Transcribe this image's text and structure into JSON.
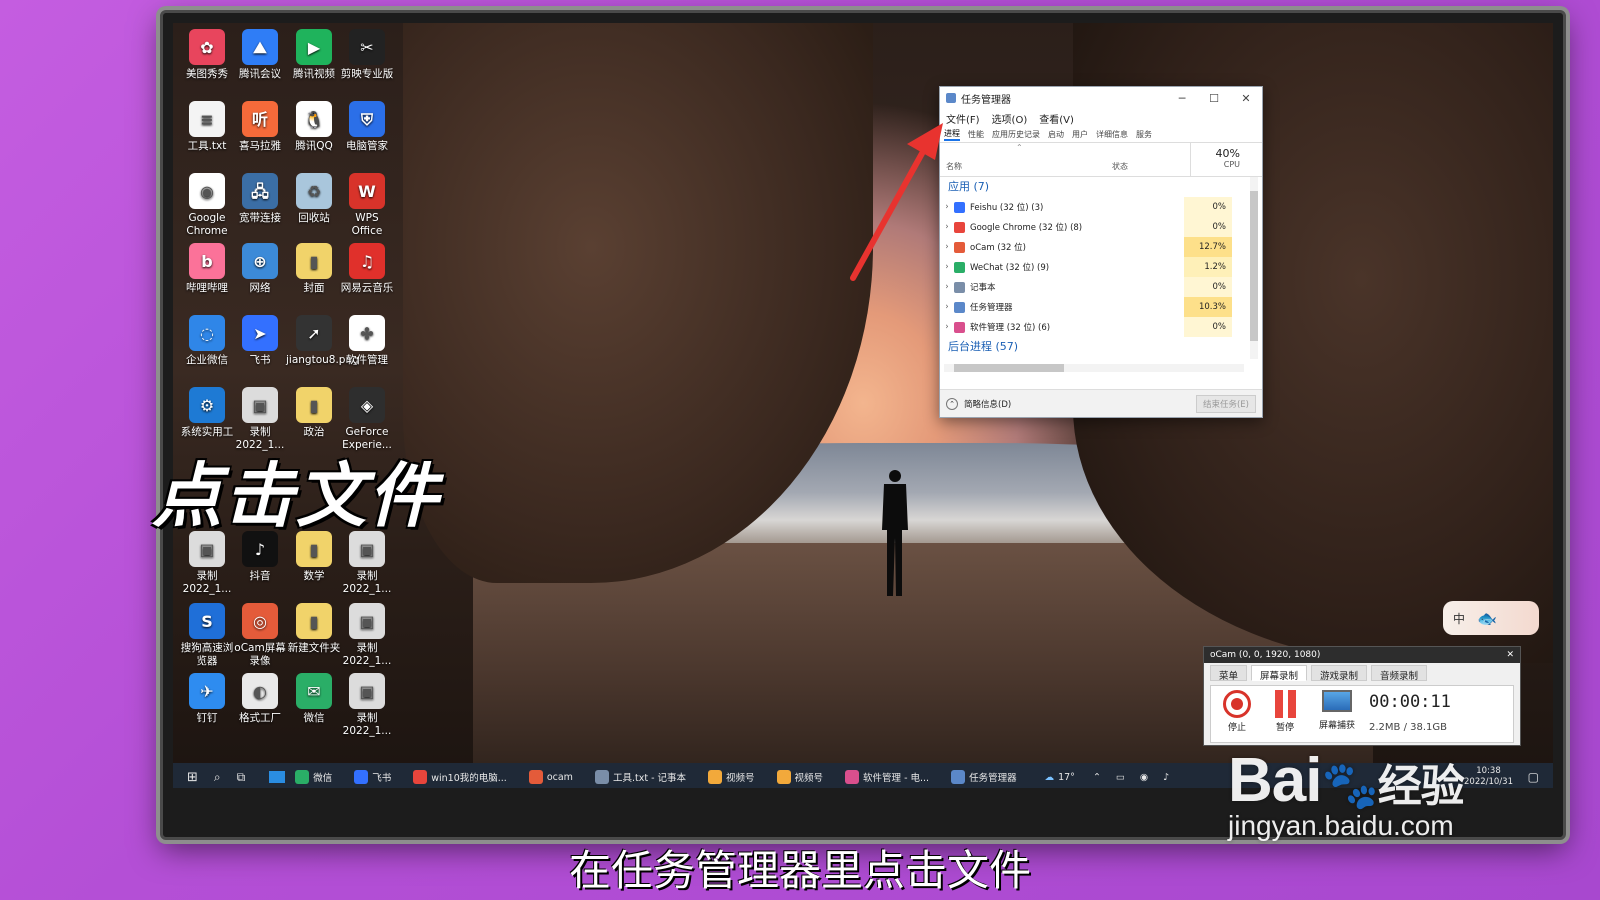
{
  "desktop_icons": [
    {
      "label": "美图秀秀",
      "color": "#e8455d",
      "glyph": "✿"
    },
    {
      "label": "腾讯会议",
      "color": "#2f7df6",
      "glyph": "⛰"
    },
    {
      "label": "腾讯视频",
      "color": "#1fb35c",
      "glyph": "▶"
    },
    {
      "label": "剪映专业版",
      "color": "#222222",
      "glyph": "✂"
    },
    {
      "label": "工具.txt",
      "color": "#f4f4f4",
      "glyph": "≡"
    },
    {
      "label": "喜马拉雅",
      "color": "#f56a3a",
      "glyph": "听"
    },
    {
      "label": "腾讯QQ",
      "color": "#ffffff",
      "glyph": "🐧"
    },
    {
      "label": "电脑管家",
      "color": "#2b6fe8",
      "glyph": "⛨"
    },
    {
      "label": "Google Chrome",
      "color": "#ffffff",
      "glyph": "◉"
    },
    {
      "label": "宽带连接",
      "color": "#3b6ea5",
      "glyph": "🖧"
    },
    {
      "label": "回收站",
      "color": "#a9c6dc",
      "glyph": "♻"
    },
    {
      "label": "WPS Office",
      "color": "#d8332a",
      "glyph": "W"
    },
    {
      "label": "哔哩哔哩",
      "color": "#fb7299",
      "glyph": "b"
    },
    {
      "label": "网络",
      "color": "#3c8ad8",
      "glyph": "⊕"
    },
    {
      "label": "封面",
      "color": "#f1d36a",
      "glyph": "▮"
    },
    {
      "label": "网易云音乐",
      "color": "#e0302b",
      "glyph": "♫"
    },
    {
      "label": "企业微信",
      "color": "#2f86e8",
      "glyph": "◌"
    },
    {
      "label": "飞书",
      "color": "#3370ff",
      "glyph": "➤"
    },
    {
      "label": "jiangtou8.png",
      "color": "#333333",
      "glyph": "➚"
    },
    {
      "label": "软件管理",
      "color": "#ffffff",
      "glyph": "✤"
    },
    {
      "label": "系统实用工",
      "color": "#1e7ad4",
      "glyph": "⚙"
    },
    {
      "label": "录制2022_1...",
      "color": "#dcdcdc",
      "glyph": "▣"
    },
    {
      "label": "政治",
      "color": "#f1d36a",
      "glyph": "▮"
    },
    {
      "label": "GeForce Experie...",
      "color": "#2e2e2e",
      "glyph": "◈"
    },
    {
      "label": "录制2022_1...",
      "color": "#dcdcdc",
      "glyph": "▣"
    },
    {
      "label": "抖音",
      "color": "#111111",
      "glyph": "♪"
    },
    {
      "label": "数学",
      "color": "#f1d36a",
      "glyph": "▮"
    },
    {
      "label": "录制2022_1...",
      "color": "#dcdcdc",
      "glyph": "▣"
    },
    {
      "label": "搜狗高速浏览器",
      "color": "#1f6fd8",
      "glyph": "S"
    },
    {
      "label": "oCam屏幕录像",
      "color": "#e45b3a",
      "glyph": "◎"
    },
    {
      "label": "新建文件夹",
      "color": "#f1d36a",
      "glyph": "▮"
    },
    {
      "label": "录制2022_1...",
      "color": "#dcdcdc",
      "glyph": "▣"
    },
    {
      "label": "钉钉",
      "color": "#2e8cf0",
      "glyph": "✈"
    },
    {
      "label": "格式工厂",
      "color": "#e9e9e9",
      "glyph": "◐"
    },
    {
      "label": "微信",
      "color": "#2aae67",
      "glyph": "✉"
    },
    {
      "label": "录制2022_1...",
      "color": "#dcdcdc",
      "glyph": "▣"
    }
  ],
  "task_manager": {
    "title": "任务管理器",
    "menu": [
      "文件(F)",
      "选项(O)",
      "查看(V)"
    ],
    "tabs": [
      "进程",
      "性能",
      "应用历史记录",
      "启动",
      "用户",
      "详细信息",
      "服务"
    ],
    "columns": {
      "name": "名称",
      "status": "状态",
      "cpu_percent": "40%",
      "cpu": "CPU"
    },
    "apps_group": "应用 (7)",
    "rows": [
      {
        "name": "Feishu (32 位) (3)",
        "cpu": "0%",
        "icon_color": "#3370ff"
      },
      {
        "name": "Google Chrome (32 位) (8)",
        "cpu": "0%",
        "icon_color": "#e8453c"
      },
      {
        "name": "oCam (32 位)",
        "cpu": "12.7%",
        "icon_color": "#e45b3a"
      },
      {
        "name": "WeChat (32 位) (9)",
        "cpu": "1.2%",
        "icon_color": "#2aae67"
      },
      {
        "name": "记事本",
        "cpu": "0%",
        "icon_color": "#7a8ea8"
      },
      {
        "name": "任务管理器",
        "cpu": "10.3%",
        "icon_color": "#5b88c9"
      },
      {
        "name": "软件管理 (32 位) (6)",
        "cpu": "0%",
        "icon_color": "#d94f8d"
      }
    ],
    "background_group": "后台进程 (57)",
    "footer_left": "简略信息(D)",
    "footer_right": "结束任务(E)"
  },
  "ocam": {
    "title": "oCam (0, 0, 1920, 1080)",
    "tabs": [
      "菜单",
      "屏幕录制",
      "游戏录制",
      "音频录制"
    ],
    "stop": "停止",
    "pause": "暂停",
    "screen": "屏幕捕获",
    "time": "00:00:11",
    "size": "2.2MB / 38.1GB"
  },
  "ime_badge": "中",
  "taskbar": {
    "items": [
      {
        "label": "微信",
        "color": "#2aae67"
      },
      {
        "label": "飞书",
        "color": "#3370ff"
      },
      {
        "label": "win10我的电脑...",
        "color": "#e8453c"
      },
      {
        "label": "ocam",
        "color": "#e45b3a"
      },
      {
        "label": "工具.txt - 记事本",
        "color": "#7a8ea8"
      },
      {
        "label": "视频号",
        "color": "#f2a93b"
      },
      {
        "label": "视频号",
        "color": "#f2a93b"
      },
      {
        "label": "软件管理 - 电...",
        "color": "#d94f8d"
      },
      {
        "label": "任务管理器",
        "color": "#5b88c9"
      }
    ],
    "weather": "17°",
    "clock_time": "10:38",
    "clock_date": "2022/10/31"
  },
  "overlay": {
    "big_caption": "点击文件",
    "subtitle": "在任务管理器里点击文件"
  },
  "watermark": {
    "logo_a": "Bai",
    "logo_b": "经验",
    "url": "jingyan.baidu.com"
  }
}
